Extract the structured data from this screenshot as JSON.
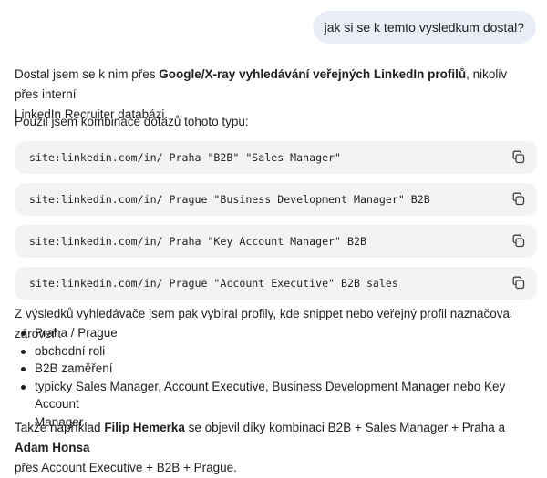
{
  "user_message": "jak si se k temto vysledkum dostal?",
  "intro": {
    "before": "Dostal jsem se k nim přes ",
    "bold": "Google/X-ray vyhledávání veřejných LinkedIn profilů",
    "after_line1": ", nikoliv přes interní",
    "line2": "LinkedIn Recruiter databázi."
  },
  "queries_intro": "Použil jsem kombinace dotazů tohoto typu:",
  "queries": [
    "site:linkedin.com/in/ Praha \"B2B\" \"Sales Manager\"",
    "site:linkedin.com/in/ Prague \"Business Development Manager\" B2B",
    "site:linkedin.com/in/ Praha \"Key Account Manager\" B2B",
    "site:linkedin.com/in/ Prague \"Account Executive\" B2B sales"
  ],
  "filter_intro": "Z výsledků vyhledávače jsem pak vybíral profily, kde snippet nebo veřejný profil naznačoval zároveň:",
  "criteria": [
    "Praha / Prague",
    "obchodní roli",
    "B2B zaměření",
    "typicky Sales Manager, Account Executive, Business Development Manager nebo Key Account",
    "Manager"
  ],
  "example": {
    "p1": "Takže například ",
    "name1": "Filip Hemerka",
    "p2": " se objevil díky kombinaci B2B + Sales Manager + Praha a ",
    "name2": "Adam Honsa",
    "line2": "přes Account Executive + B2B + Prague."
  },
  "icons": {
    "copy": "copy-icon"
  }
}
